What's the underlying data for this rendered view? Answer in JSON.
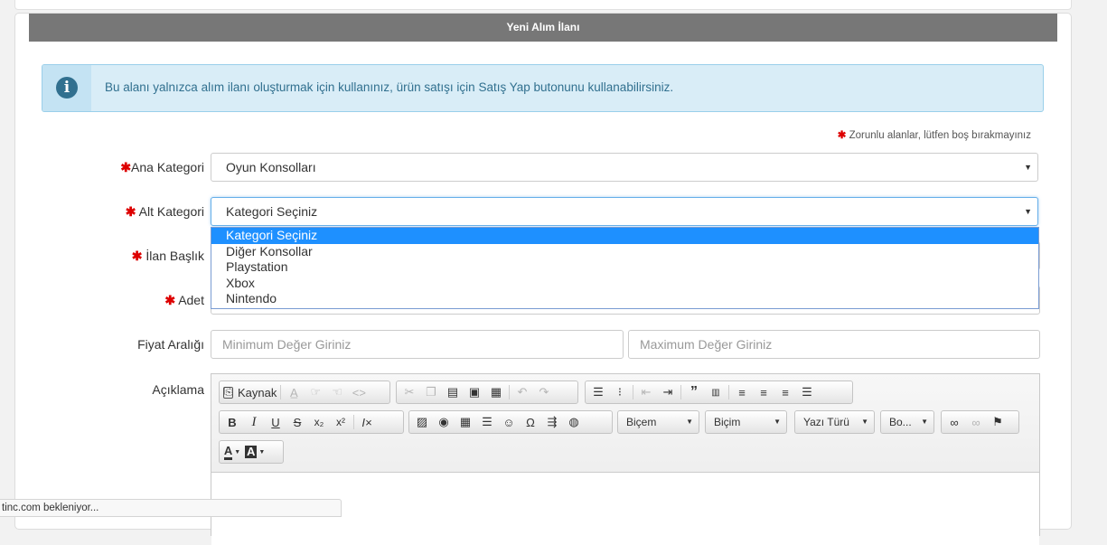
{
  "panel": {
    "title": "Yeni Alım İlanı"
  },
  "alert": {
    "icon": "info-icon",
    "text": "Bu alanı yalnızca alım ilanı oluşturmak için kullanınız, ürün satışı için Satış Yap butonunu kullanabilirsiniz."
  },
  "required_note": {
    "star": "✱",
    "text": "Zorunlu alanlar, lütfen boş bırakmayınız"
  },
  "form": {
    "ana_kategori": {
      "star": "✱",
      "label": "Ana Kategori",
      "value": "Oyun Konsolları"
    },
    "alt_kategori": {
      "star": "✱",
      "label": "Alt Kategori",
      "value": "Kategori Seçiniz",
      "options": [
        "Kategori Seçiniz",
        "Diğer Konsollar",
        "Playstation",
        "Xbox",
        "Nintendo"
      ],
      "selected_index": 0
    },
    "ilan_baslik": {
      "star": "✱",
      "label": "İlan Başlık"
    },
    "adet": {
      "star": "✱",
      "label": "Adet"
    },
    "fiyat": {
      "label": "Fiyat Aralığı",
      "min_placeholder": "Minimum Değer Giriniz",
      "max_placeholder": "Maximum Değer Giriniz"
    },
    "aciklama": {
      "label": "Açıklama"
    }
  },
  "editor": {
    "source_label": "Kaynak",
    "format_label": "Biçem",
    "style_label": "Biçim",
    "font_label": "Yazı Türü",
    "size_label": "Bo...",
    "color_glyph": "A"
  },
  "status_bar": {
    "text": "tinc.com bekleniyor..."
  },
  "colors": {
    "header": "#777777",
    "alert_bg": "#d9edf7",
    "alert_text": "#31708f",
    "required": "#dd0000",
    "highlight": "#1e90ff"
  }
}
